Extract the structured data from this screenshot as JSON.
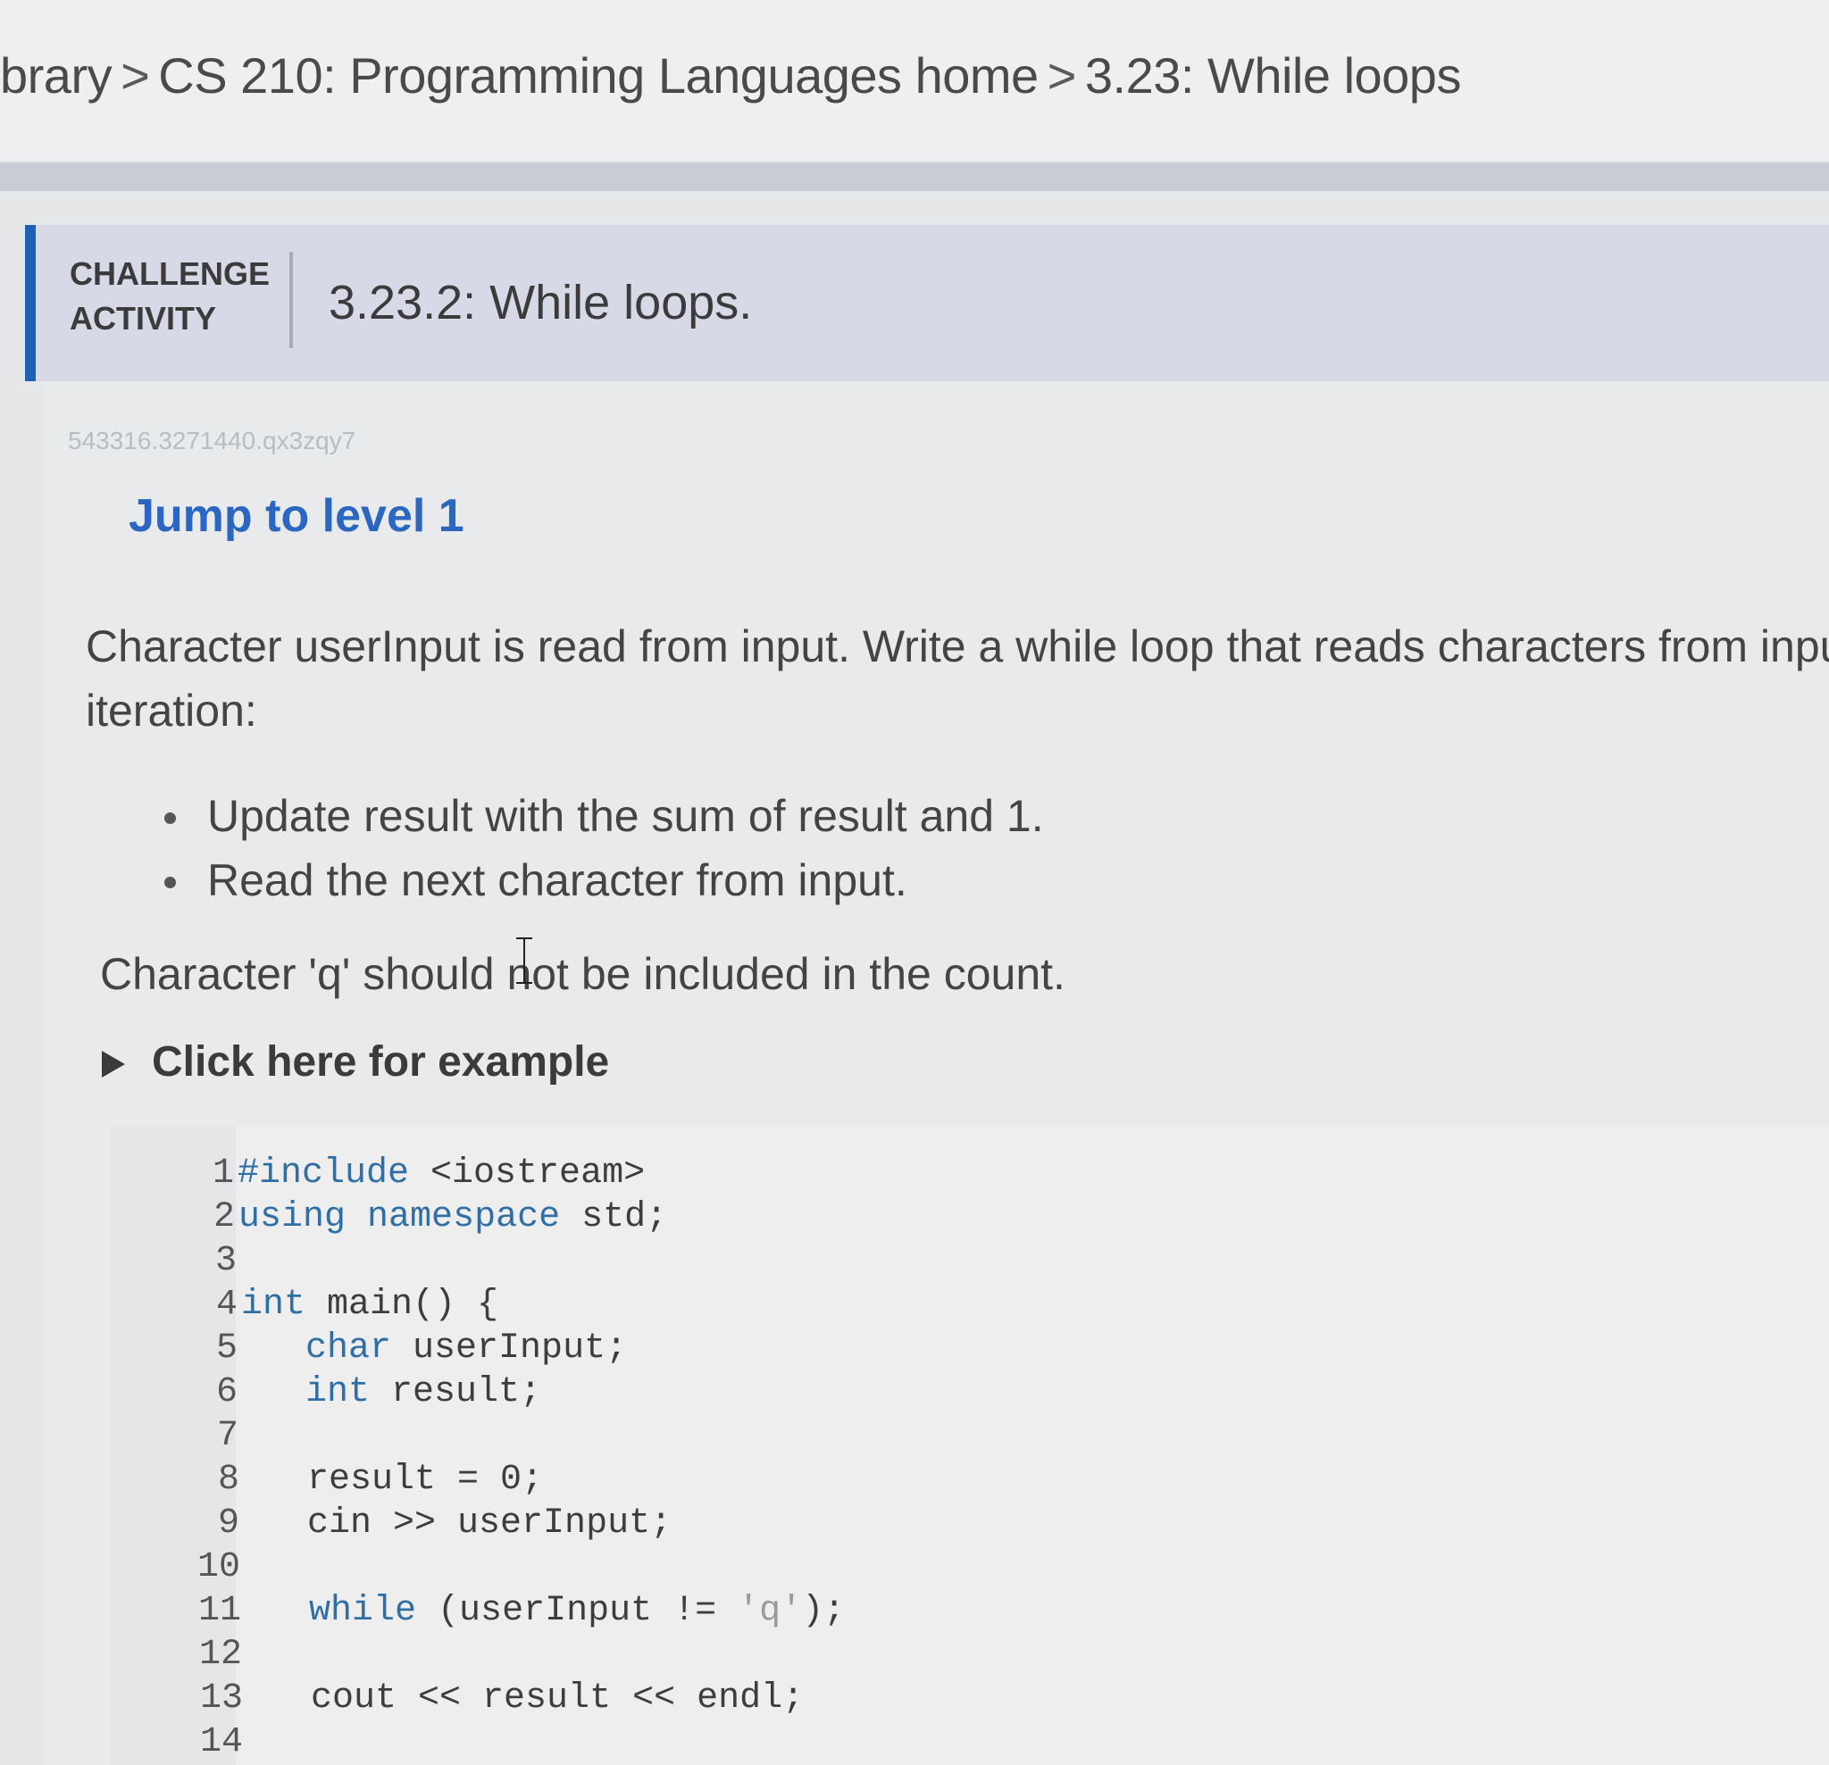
{
  "breadcrumb": {
    "items": [
      "brary",
      "CS 210: Programming Languages home",
      "3.23: While loops"
    ],
    "separator": ">"
  },
  "challenge": {
    "label_line1": "CHALLENGE",
    "label_line2": "ACTIVITY",
    "title": "3.23.2: While loops.",
    "activity_id": "543316.3271440.qx3zqy7",
    "accent_color": "#1f5fb4"
  },
  "jump_link": "Jump to level 1",
  "prompt": {
    "line1": "Character userInput is read from input. Write a while loop that reads characters from input",
    "line2": "iteration:"
  },
  "bullets": [
    "Update result with the sum of result and 1.",
    "Read the next character from input."
  ],
  "note": "Character 'q' should not be included in the count.",
  "example_toggle": "Click here for example",
  "code_lines": [
    {
      "n": "1",
      "text": "#include <iostream>"
    },
    {
      "n": "2",
      "text": "using namespace std;"
    },
    {
      "n": "3",
      "text": ""
    },
    {
      "n": "4",
      "text": "int main() {"
    },
    {
      "n": "5",
      "text": "   char userInput;"
    },
    {
      "n": "6",
      "text": "   int result;"
    },
    {
      "n": "7",
      "text": ""
    },
    {
      "n": "8",
      "text": "   result = 0;"
    },
    {
      "n": "9",
      "text": "   cin >> userInput;"
    },
    {
      "n": "10",
      "text": ""
    },
    {
      "n": "11",
      "text": "   while (userInput != 'q');"
    },
    {
      "n": "12",
      "text": ""
    },
    {
      "n": "13",
      "text": "   cout << result << endl;"
    },
    {
      "n": "14",
      "text": ""
    }
  ]
}
